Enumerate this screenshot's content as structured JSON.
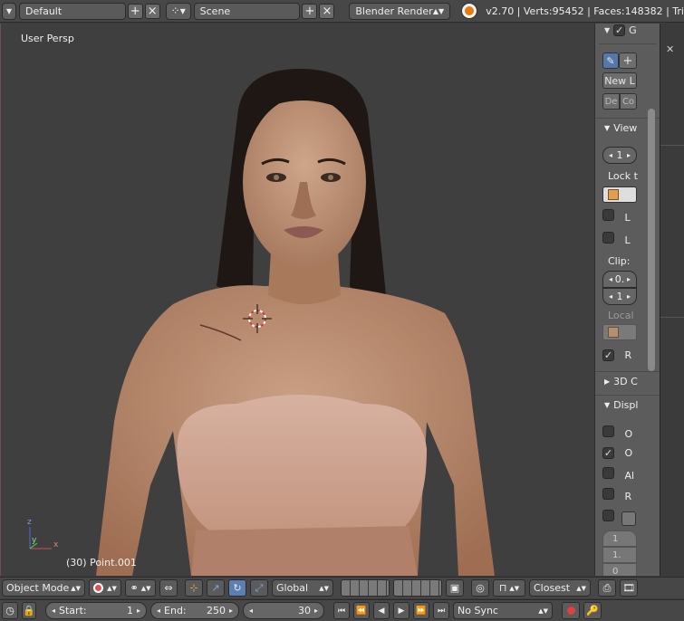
{
  "header": {
    "layout_name": "Default",
    "scene_name": "Scene",
    "render_engine": "Blender Render",
    "stats": "v2.70 | Verts:95452 | Faces:148382 | Tri"
  },
  "viewport": {
    "view_name": "User Persp",
    "object_info": "(30) Point.001",
    "axis_z": "z",
    "axis_y": "y",
    "axis_x": "x"
  },
  "npanel": {
    "tab_g": "G",
    "new_label": "New L",
    "de_label": "De",
    "co_label": "Co",
    "view_head": "View",
    "lens_value": "1",
    "lock_label": "Lock t",
    "l1": "L",
    "l2": "L",
    "clip_label": "Clip:",
    "clip_start": "0.",
    "clip_end": "1",
    "local_label": "Local",
    "r_label": "R",
    "cursor_head": "3D C",
    "display_head": "Displ",
    "o1": "O",
    "o2": "O",
    "al": "Al",
    "r2": "R",
    "v1": "1",
    "v2": "1.",
    "v3": "0"
  },
  "view_header": {
    "mode": "Object Mode",
    "orientation": "Global",
    "snap_target": "Closest"
  },
  "timeline": {
    "start_label": "Start:",
    "start_value": "1",
    "end_label": "End:",
    "end_value": "250",
    "current_frame": "30",
    "sync": "No Sync"
  },
  "colors": {
    "bg_viewport": "#3f3f3f",
    "panel": "#5c5c5c",
    "skin": "#b98462",
    "hair": "#1e1714"
  }
}
